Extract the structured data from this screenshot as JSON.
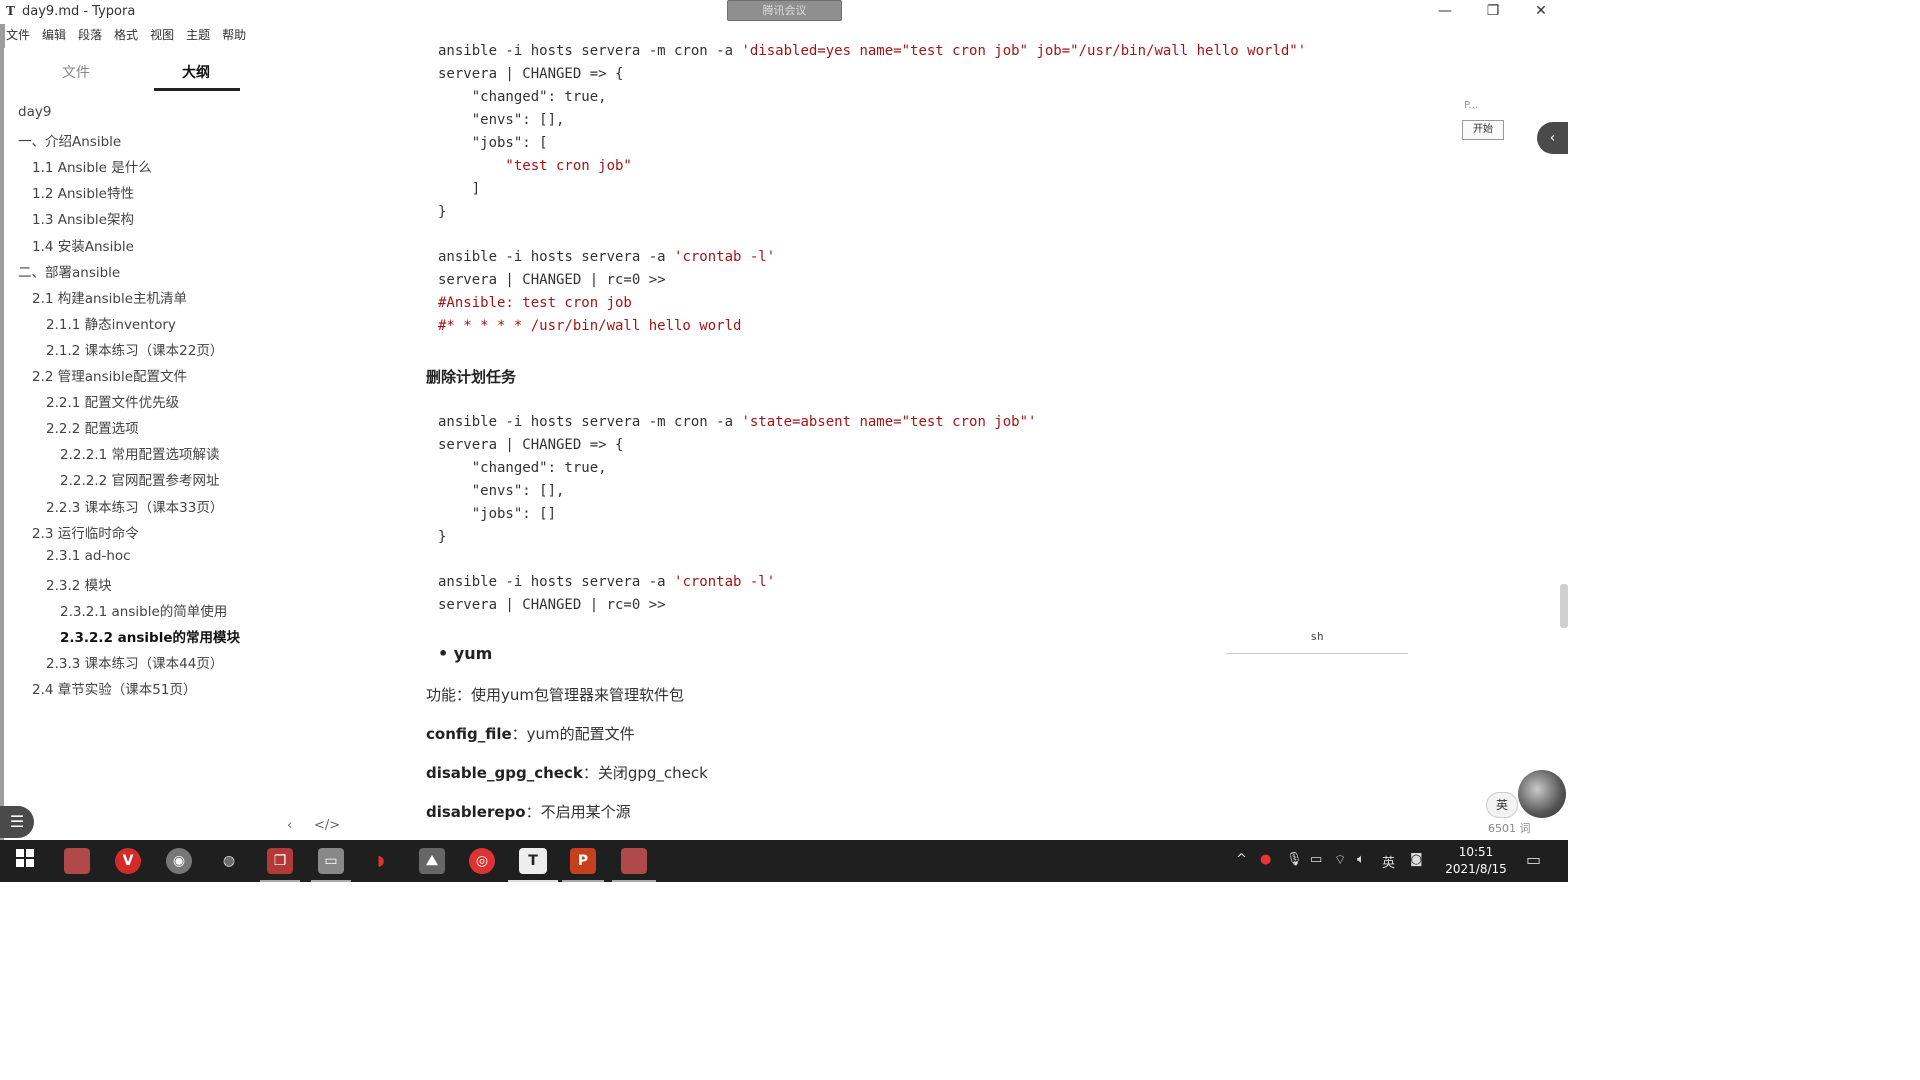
{
  "window": {
    "app_icon": "T",
    "title": "day9.md - Typora",
    "meeting_bar": "腾讯会议",
    "minimize": "—",
    "restore": "❐",
    "close": "✕"
  },
  "menu": [
    "文件",
    "编辑",
    "段落",
    "格式",
    "视图",
    "主题",
    "帮助"
  ],
  "sidebar": {
    "tabs": [
      {
        "label": "文件"
      },
      {
        "label": "大纲",
        "active": true
      }
    ],
    "outline": [
      {
        "label": "day9",
        "level": 0
      },
      {
        "label": "一、介绍Ansible",
        "level": 0
      },
      {
        "label": "1.1 Ansible 是什么",
        "level": 1
      },
      {
        "label": "1.2 Ansible特性",
        "level": 1
      },
      {
        "label": "1.3 Ansible架构",
        "level": 1
      },
      {
        "label": "1.4 安装Ansible",
        "level": 1
      },
      {
        "label": "二、部署ansible",
        "level": 0
      },
      {
        "label": "2.1 构建ansible主机清单",
        "level": 1
      },
      {
        "label": "2.1.1 静态inventory",
        "level": 2
      },
      {
        "label": "2.1.2 课本练习（课本22页）",
        "level": 2
      },
      {
        "label": "2.2 管理ansible配置文件",
        "level": 1
      },
      {
        "label": "2.2.1 配置文件优先级",
        "level": 2
      },
      {
        "label": "2.2.2 配置选项",
        "level": 2
      },
      {
        "label": "2.2.2.1 常用配置选项解读",
        "level": 3
      },
      {
        "label": "2.2.2.2 官网配置参考网址",
        "level": 3
      },
      {
        "label": "2.2.3 课本练习（课本33页）",
        "level": 2
      },
      {
        "label": "2.3 运行临时命令",
        "level": 1
      },
      {
        "label": "2.3.1 ad-hoc",
        "level": 2
      },
      {
        "label": "2.3.2 模块",
        "level": 2
      },
      {
        "label": "2.3.2.1 ansible的简单使用",
        "level": 3
      },
      {
        "label": "2.3.2.2 ansible的常用模块",
        "level": 3,
        "active": true
      },
      {
        "label": "2.3.3 课本练习（课本44页）",
        "level": 2
      },
      {
        "label": "2.4 章节实验（课本51页）",
        "level": 1
      }
    ],
    "footer_prev": "‹",
    "footer_code": "</>",
    "outline_toggle": "☰"
  },
  "content": {
    "block1": {
      "cmd_prefix": "ansible -i hosts servera -m cron -a ",
      "cmd_arg": "'disabled=yes name=\"test cron job\" job=\"/usr/bin/wall hello world\"'",
      "lines": [
        "servera | CHANGED => {",
        "    \"changed\": true,",
        "    \"envs\": [],",
        "    \"jobs\": [",
        "        \"test cron job\"",
        "    ]",
        "}"
      ]
    },
    "block2": {
      "cmd_prefix": "ansible -i hosts servera -a ",
      "cmd_arg": "'crontab -l'",
      "line1": "servera | CHANGED | rc=0 >>",
      "comment1": "#Ansible: test cron job",
      "comment2": "#* * * * * /usr/bin/wall hello world"
    },
    "heading_delete": "删除计划任务",
    "block3": {
      "cmd_prefix": "ansible -i hosts servera -m cron -a ",
      "cmd_arg": "'state=absent name=\"test cron job\"'",
      "lines": [
        "servera | CHANGED => {",
        "    \"changed\": true,",
        "    \"envs\": [],",
        "    \"jobs\": []",
        "}"
      ]
    },
    "block4": {
      "cmd_prefix": "ansible -i hosts servera -a ",
      "cmd_arg": "'crontab -l'",
      "line1": "servera | CHANGED | rc=0 >>"
    },
    "code_lang": "sh",
    "bullet_yum": "yum",
    "para_func_label": "功能：",
    "para_func_text": "使用yum包管理器来管理软件包",
    "para_config_label": "config_file",
    "para_config_text": "：yum的配置文件",
    "para_gpg_label": "disable_gpg_check",
    "para_gpg_text": "：关闭gpg_check",
    "para_repo_label": "disablerepo",
    "para_repo_text": "：不启用某个源"
  },
  "widgets": {
    "ppt_label": "P...",
    "ppt_start": "开始",
    "side_arrow": "‹",
    "ime_label": "英",
    "word_count": "6501 词"
  },
  "taskbar": {
    "icons": [
      "start-icon",
      "app-icon",
      "vivaldi-icon",
      "chrome-icon",
      "wechat-icon",
      "remote-icon",
      "explorer-icon",
      "netease-icon",
      "photos-icon",
      "netease-music-icon",
      "typora-icon",
      "powerpoint-icon",
      "app2-icon"
    ],
    "typora_letter": "T",
    "ppt_letter": "P",
    "tray_ime": "英",
    "time": "10:51",
    "date": "2021/8/15"
  }
}
